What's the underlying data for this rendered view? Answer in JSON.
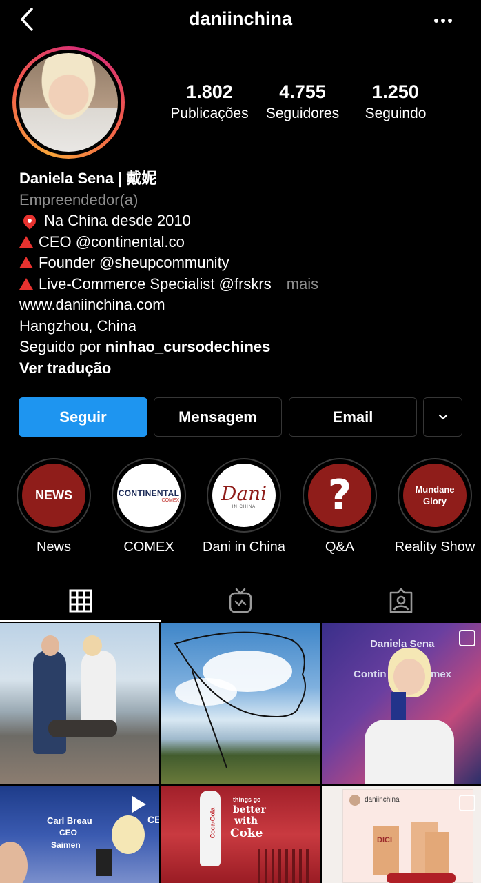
{
  "header": {
    "username": "daniinchina",
    "back_icon": "chevron-left-icon",
    "more_icon": "ellipsis-icon"
  },
  "stats": [
    {
      "value": "1.802",
      "label": "Publicações"
    },
    {
      "value": "4.755",
      "label": "Seguidores"
    },
    {
      "value": "1.250",
      "label": "Seguindo"
    }
  ],
  "bio": {
    "name": "Daniela Sena | 戴妮",
    "category": "Empreendedor(a)",
    "line1": "Na China desde 2010",
    "line2": "CEO @continental.co",
    "line3": "Founder @sheupcommunity",
    "line4": "Live-Commerce Specialist @frskrs",
    "more": "mais",
    "website": "www.daniinchina.com",
    "location": "Hangzhou, China",
    "followed_prefix": "Seguido por ",
    "followed_user": "ninhao_cursodechines",
    "translate": "Ver tradução"
  },
  "buttons": {
    "follow": "Seguir",
    "message": "Mensagem",
    "email": "Email"
  },
  "highlights": [
    {
      "label": "News",
      "cover": "NEWS"
    },
    {
      "label": "COMEX",
      "cover": "CONTINENTAL",
      "cover_sub": "COMEX"
    },
    {
      "label": "Dani in China",
      "cover": "Dani",
      "cover_sub": "IN CHINA"
    },
    {
      "label": "Q&A",
      "cover": "?"
    },
    {
      "label": "Reality Show",
      "cover": "Mundane Glory"
    }
  ],
  "posts": {
    "p3_title": "Daniela Sena",
    "p3_sub": "Contin",
    "p3_sub2": "mex",
    "p4_l1": "Carl Breau",
    "p4_l2": "CEO",
    "p4_l3": "Saimen",
    "p4_side": "CE",
    "p5_text": "Coca-Cola",
    "p5_slogan1": "things go",
    "p5_slogan2": "better",
    "p5_slogan3": "with",
    "p5_slogan4": "Coke",
    "p6_user": "daniinchina",
    "p6_brand": "DICI"
  },
  "colors": {
    "follow_blue": "#1e95f0",
    "highlight_red": "#8f1d1a",
    "accent_red": "#e8322f"
  }
}
